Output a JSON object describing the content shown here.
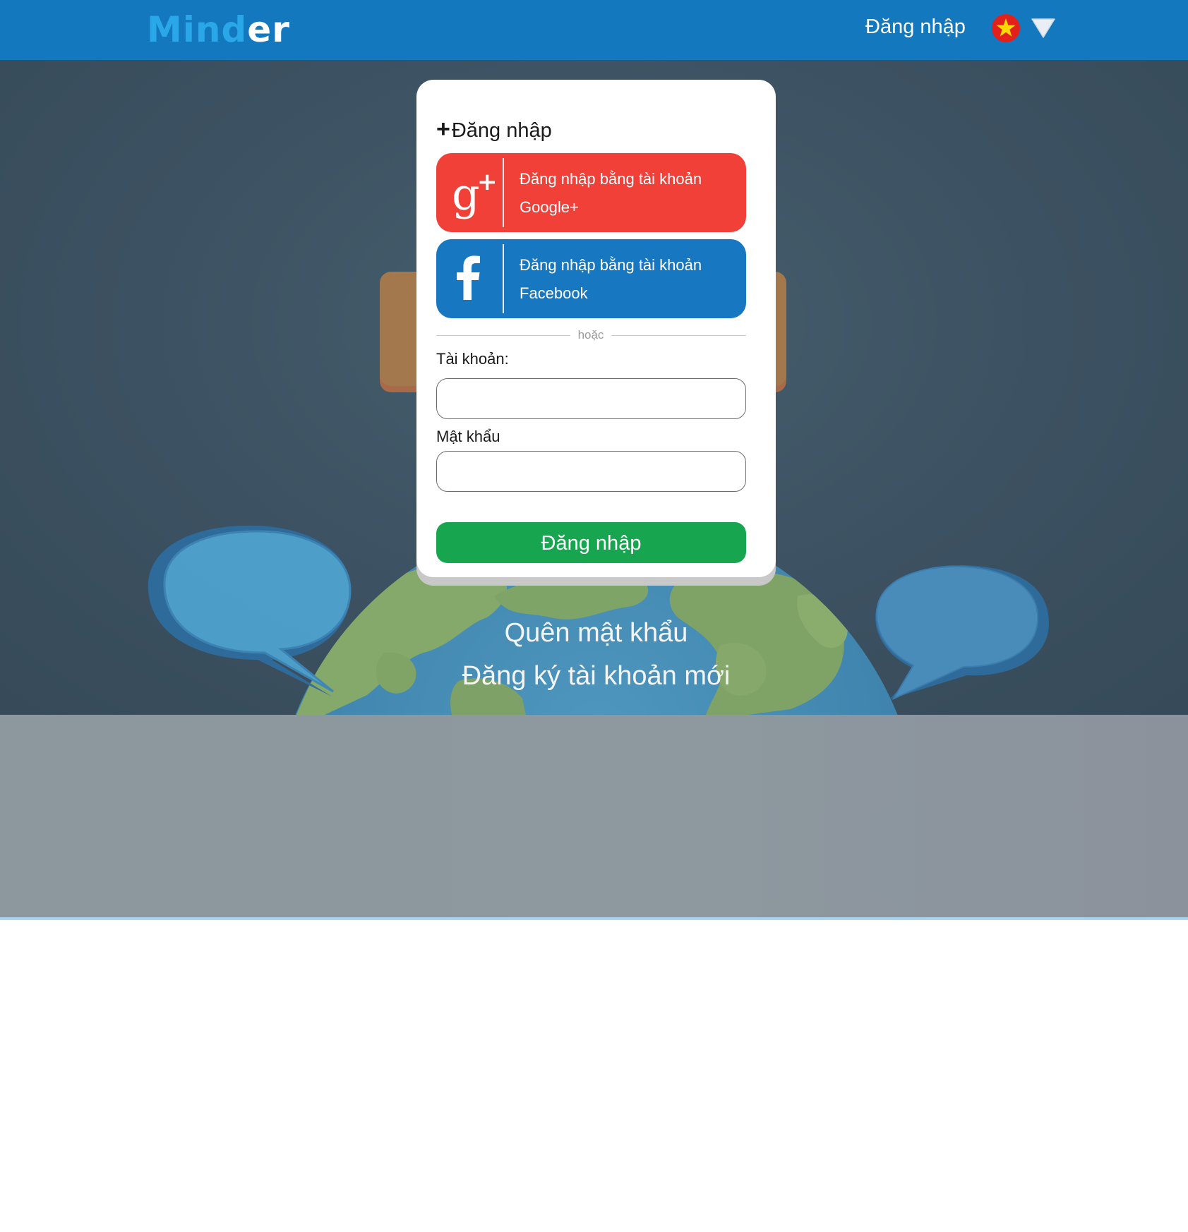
{
  "header": {
    "logo_part1": "Mind",
    "logo_part2": "er",
    "login_link": "Đăng nhập",
    "language": "vietnam-flag",
    "language_dropdown_icon": "triangle-down-icon"
  },
  "login_card": {
    "title_icon": "plus-icon",
    "title": "Đăng nhập",
    "google_button": {
      "icon": "google-plus-icon",
      "label": "Đăng nhập bằng tài khoản Google+"
    },
    "facebook_button": {
      "icon": "facebook-icon",
      "label": "Đăng nhập bằng tài khoản Facebook"
    },
    "separator": "hoặc",
    "username_label": "Tài khoản:",
    "username_value": "",
    "password_label": "Mật khẩu",
    "password_value": "",
    "submit_label": "Đăng nhập"
  },
  "hero": {
    "forgot_password": "Quên mật khẩu",
    "register": "Đăng ký tài khoản mới"
  },
  "colors": {
    "header": "#1478be",
    "logo_accent": "#2aa7e8",
    "google": "#f04037",
    "facebook": "#1777c0",
    "submit": "#18a54f",
    "hero_background": "#3c5161",
    "footer_band": "#8c979e"
  }
}
